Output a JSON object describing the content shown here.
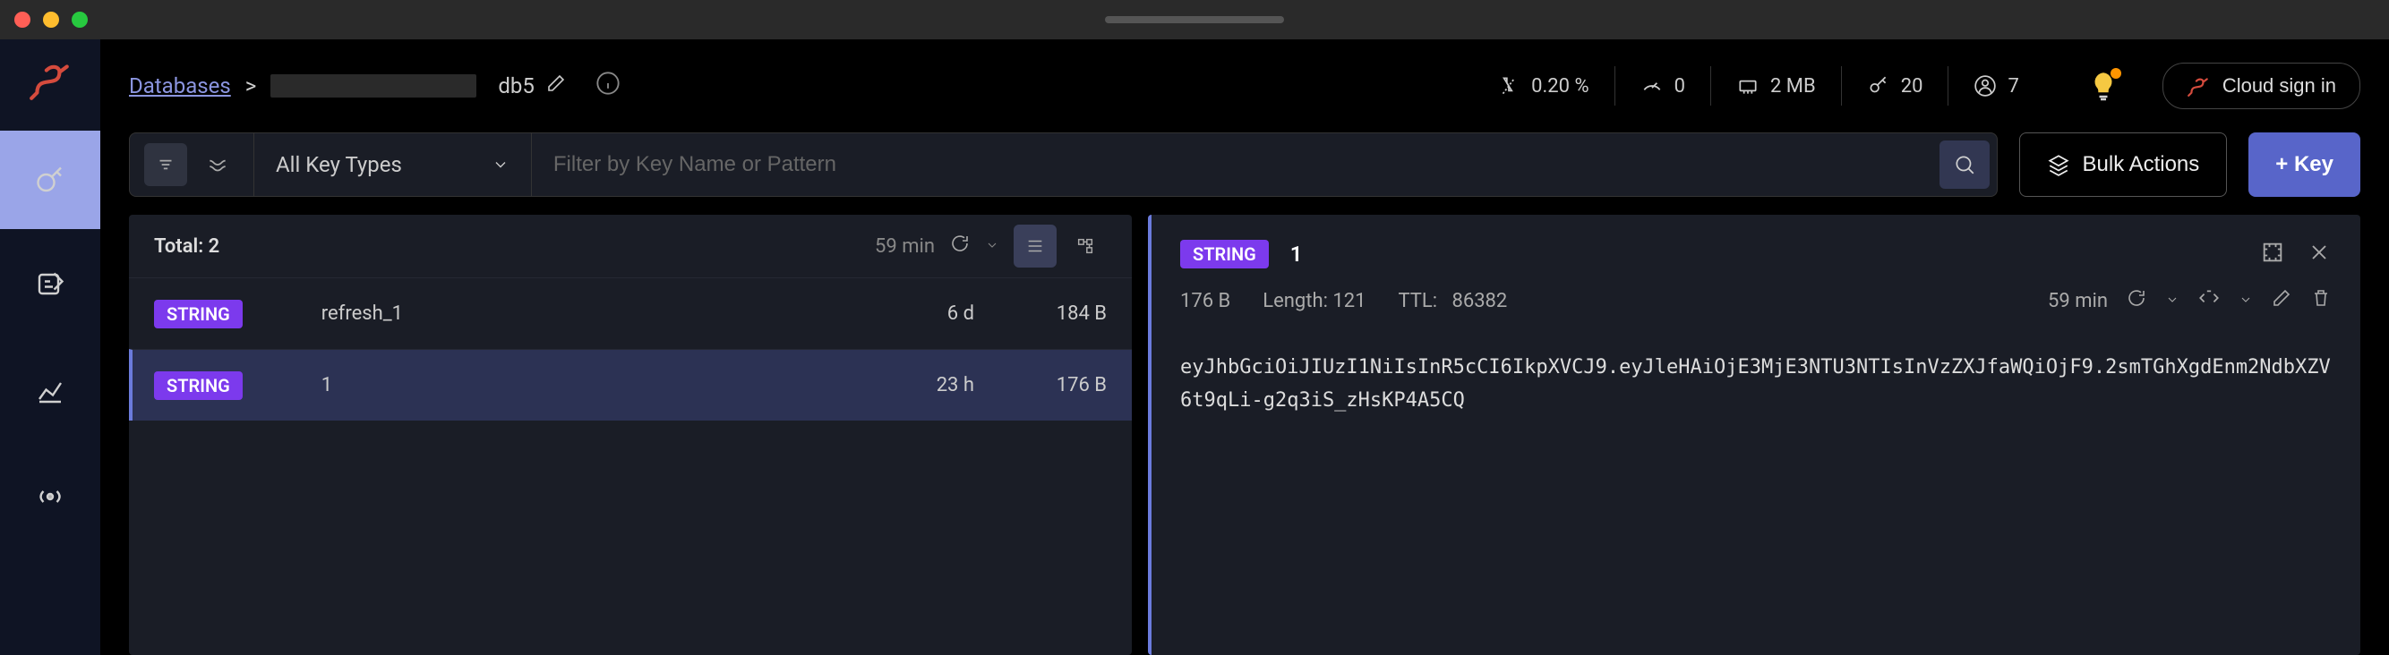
{
  "breadcrumb": {
    "databases_label": "Databases",
    "separator": ">",
    "db_name": "db5"
  },
  "header_stats": {
    "cpu": "0.20 %",
    "latency": "0",
    "memory": "2 MB",
    "keys": "20",
    "clients": "7"
  },
  "cloud_sign_in": "Cloud sign in",
  "filters": {
    "key_type_label": "All Key Types",
    "search_placeholder": "Filter by Key Name or Pattern"
  },
  "bulk_actions_label": "Bulk Actions",
  "add_key_label": "+ Key",
  "key_list": {
    "total_label": "Total: 2",
    "refresh_age": "59 min",
    "rows": [
      {
        "type": "STRING",
        "name": "refresh_1",
        "ttl": "6 d",
        "size": "184 B"
      },
      {
        "type": "STRING",
        "name": "1",
        "ttl": "23 h",
        "size": "176 B"
      }
    ]
  },
  "details": {
    "type_badge": "STRING",
    "key_name": "1",
    "size": "176 B",
    "length_label": "Length: 121",
    "ttl_label": "TTL:",
    "ttl_value": "86382",
    "refresh_age": "59 min",
    "value": "eyJhbGciOiJIUzI1NiIsInR5cCI6IkpXVCJ9.eyJleHAiOjE3MjE3NTU3NTIsInVzZXJfaWQiOjF9.2smTGhXgdEnm2NdbXZV6t9qLi-g2q3iS_zHsKP4A5CQ"
  }
}
